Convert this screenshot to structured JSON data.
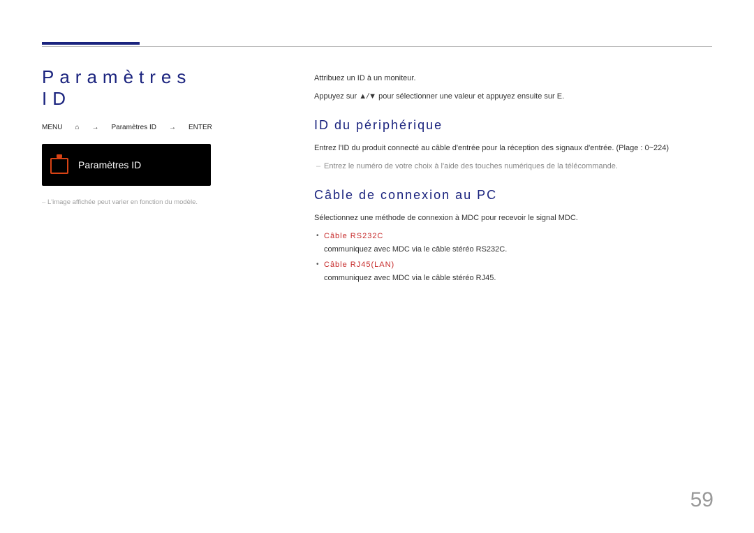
{
  "title": "Paramètres ID",
  "nav": {
    "menu": "MENU",
    "arrow": "→",
    "settings": "Paramètres ID",
    "enter": "ENTER"
  },
  "osd": {
    "label": "Paramètres ID",
    "iconName": "settings-id-icon"
  },
  "note": "L'image affichée peut varier en fonction du modèle.",
  "intro1": "Attribuez un ID à un moniteur.",
  "intro2a": "Appuyez sur ",
  "intro2key1": "▲/▼",
  "intro2b": " pour sélectionner une valeur et appuyez ensuite sur ",
  "intro2key2": "E",
  "intro2c": ".",
  "sec1": {
    "heading": "ID du périphérique",
    "body": "Entrez l'ID du produit connecté au câble d'entrée pour la réception des signaux d'entrée. (Plage : 0~224)",
    "bullet": "Entrez le numéro de votre choix à l'aide des touches numériques de la télécommande."
  },
  "sec2": {
    "heading": "Câble de connexion au PC",
    "body": "Sélectionnez une méthode de connexion à MDC pour recevoir le signal MDC.",
    "opt1": {
      "label": "Câble RS232C",
      "desc": "communiquez avec MDC via le câble stéréo RS232C."
    },
    "opt2": {
      "label": "Câble RJ45(LAN)",
      "desc": "communiquez avec MDC via le câble stéréo RJ45."
    }
  },
  "pageNumber": "59"
}
